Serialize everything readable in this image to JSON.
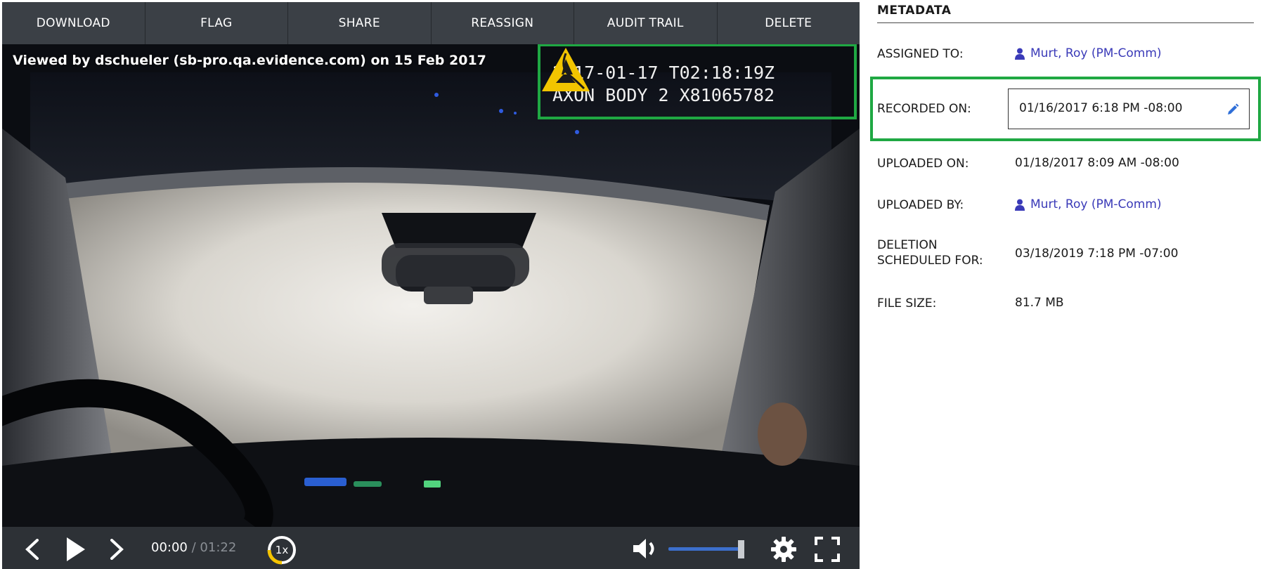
{
  "toolbar": {
    "download": "DOWNLOAD",
    "flag": "FLAG",
    "share": "SHARE",
    "reassign": "REASSIGN",
    "audit_trail": "AUDIT TRAIL",
    "delete": "DELETE"
  },
  "video": {
    "viewed_by": "Viewed by dschueler (sb-pro.qa.evidence.com) on 15 Feb 2017",
    "overlay_line1": "2017-01-17 T02:18:19Z",
    "overlay_line2": "AXON BODY 2 X81065782",
    "logo_icon": "axon-triangle-logo"
  },
  "controls": {
    "current_time": "00:00",
    "separator": "/",
    "duration": "01:22",
    "speed": "1x",
    "volume_level": 0.93,
    "icons": [
      "chevron-left-icon",
      "play-icon",
      "chevron-right-icon",
      "volume-icon",
      "gear-icon",
      "fullscreen-icon"
    ]
  },
  "metadata": {
    "heading": "METADATA",
    "assigned_to_label": "ASSIGNED TO:",
    "assigned_to_value": "Murt, Roy (PM-Comm)",
    "recorded_on_label": "RECORDED ON:",
    "recorded_on_value": "01/16/2017 6:18 PM -08:00",
    "uploaded_on_label": "UPLOADED ON:",
    "uploaded_on_value": "01/18/2017 8:09 AM -08:00",
    "uploaded_by_label": "UPLOADED BY:",
    "uploaded_by_value": "Murt, Roy (PM-Comm)",
    "deletion_label_line1": "DELETION",
    "deletion_label_line2": "SCHEDULED FOR:",
    "deletion_value": "03/18/2019 7:18 PM -07:00",
    "file_size_label": "FILE SIZE:",
    "file_size_value": "81.7 MB"
  },
  "colors": {
    "highlight_green": "#1fa843",
    "link_blue": "#3a3ab8",
    "toolbar_bg": "#3b4046",
    "controls_bg": "#2d3136",
    "volume_blue": "#3c6fcc",
    "speed_yellow": "#f5c400"
  }
}
